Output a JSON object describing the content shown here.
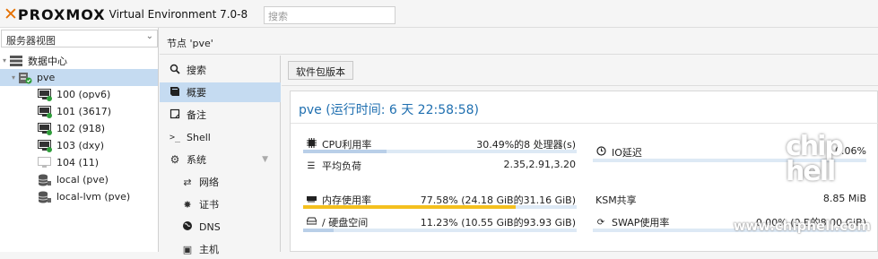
{
  "header": {
    "brand": "PROXMOX",
    "version": "Virtual Environment 7.0-8",
    "search_placeholder": "搜索"
  },
  "sidebar": {
    "view": "服务器视图",
    "tree": [
      {
        "label": "数据中心",
        "icon": "datacenter-icon"
      },
      {
        "label": "pve",
        "icon": "node-online-icon"
      },
      {
        "label": "100 (opv6)",
        "icon": "vm-running-icon"
      },
      {
        "label": "101 (3617)",
        "icon": "vm-running-icon"
      },
      {
        "label": "102 (918)",
        "icon": "vm-running-icon"
      },
      {
        "label": "103 (dxy)",
        "icon": "vm-running-icon"
      },
      {
        "label": "104 (11)",
        "icon": "vm-stopped-icon"
      },
      {
        "label": "local (pve)",
        "icon": "storage-icon"
      },
      {
        "label": "local-lvm (pve)",
        "icon": "storage-icon"
      }
    ]
  },
  "breadcrumb": "节点 'pve'",
  "nav": {
    "items": [
      {
        "label": "搜索",
        "icon": "search-icon"
      },
      {
        "label": "概要",
        "icon": "book-icon"
      },
      {
        "label": "备注",
        "icon": "note-icon"
      },
      {
        "label": "Shell",
        "icon": "terminal-icon"
      },
      {
        "label": "系统",
        "icon": "gears-icon"
      },
      {
        "label": "网络",
        "icon": "network-icon"
      },
      {
        "label": "证书",
        "icon": "certificate-icon"
      },
      {
        "label": "DNS",
        "icon": "globe-icon"
      },
      {
        "label": "主机",
        "icon": "host-icon"
      }
    ]
  },
  "toolbar": {
    "package_versions": "软件包版本"
  },
  "summary": {
    "title": "pve (运行时间: 6 天 22:58:58)",
    "cpu_label": "CPU利用率",
    "cpu_value": "30.49%的8 处理器(s)",
    "cpu_fraction": 0.3049,
    "load_label": "平均负荷",
    "load_value": "2.35,2.91,3.20",
    "io_label": "IO延迟",
    "io_value": "0.06%",
    "mem_label": "内存使用率",
    "mem_value": "77.58% (24.18 GiB的31.16 GiB)",
    "mem_fraction": 0.7758,
    "ksm_label": "KSM共享",
    "ksm_value": "8.85 MiB",
    "disk_label": "/ 硬盘空间",
    "disk_value": "11.23% (10.55 GiB的93.93 GiB)",
    "disk_fraction": 0.1123,
    "swap_label": "SWAP使用率",
    "swap_value": "0.00% (0 B的8.00 GiB)"
  },
  "watermark": {
    "site": "www.chiphell.com",
    "mark": "chip hell"
  },
  "colors": {
    "brand": "#e57000",
    "selected": "#c5dbf1",
    "title": "#1f6fb0",
    "mem_bar": "#f4c01e",
    "running": "#2e9d3a"
  }
}
